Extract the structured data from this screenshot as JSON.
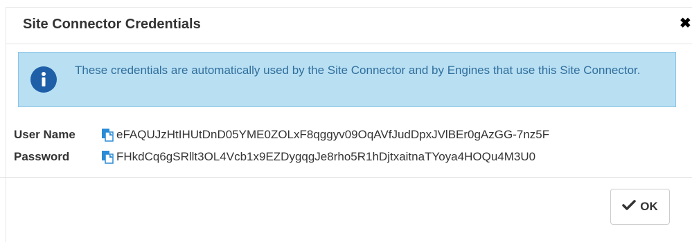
{
  "dialog": {
    "title": "Site Connector Credentials",
    "close_icon": "close-icon"
  },
  "info": {
    "icon": "info-icon",
    "message": "These credentials are automatically used by the Site Connector and by Engines that use this Site Connector."
  },
  "credentials": {
    "user_name_label": "User Name",
    "user_name_value": "eFAQUJzHtIHUtDnD05YME0ZOLxF8qggyv09OqAVfJudDpxJVlBEr0gAzGG-7nz5F",
    "password_label": "Password",
    "password_value": "FHkdCq6gSRllt3OL4Vcb1x9EZDygqgJe8rho5R1hDjtxaitnaTYoya4HOQu4M3U0",
    "copy_icon": "copy-icon"
  },
  "footer": {
    "ok_label": "OK",
    "ok_icon": "check-icon"
  },
  "colors": {
    "info_bg": "#b9dff3",
    "info_border": "#8cc4e6",
    "info_text": "#2f6f9c",
    "info_icon": "#1e5fa8",
    "copy_icon": "#2a8bd6"
  }
}
